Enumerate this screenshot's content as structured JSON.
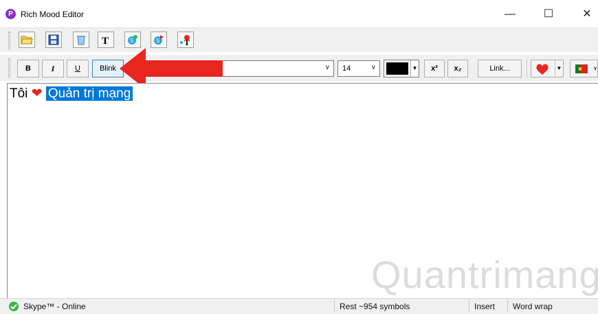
{
  "window": {
    "title": "Rich Mood Editor",
    "app_icon_letter": "P",
    "minimize_label": "—",
    "maximize_label": "☐",
    "close_label": "✕"
  },
  "toolbar_icons": [
    "open-icon",
    "save-icon",
    "clear-icon",
    "font-icon",
    "skype-add-icon",
    "skype-refresh-icon",
    "skype-tools-icon"
  ],
  "format_toolbar": {
    "bold_label": "B",
    "italic_label": "I",
    "underline_label": "U",
    "blink_label": "Blink",
    "font_size": "14",
    "superscript_label": "x²",
    "subscript_label": "x₂",
    "link_label": "Link..."
  },
  "editor": {
    "text_prefix": "Tôi",
    "emoji": "❤",
    "selected_text": "Quản trị mạng"
  },
  "statusbar": {
    "skype_status": "Skype™ - Online",
    "rest": "Rest ~954 symbols",
    "insert": "Insert",
    "word_wrap": "Word wrap"
  },
  "watermark": "Quantrimang",
  "colors": {
    "accent_red": "#e8251f",
    "selection": "#0078d7",
    "app_icon": "#8b2fc9"
  }
}
